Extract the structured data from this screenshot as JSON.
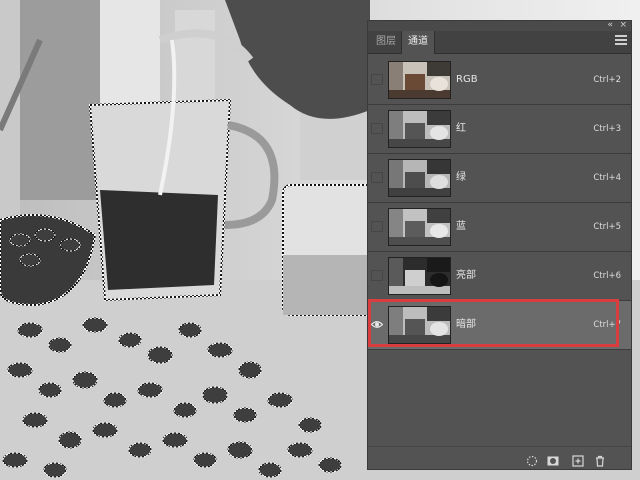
{
  "panel": {
    "collapse_glyph": "«",
    "close_glyph": "×",
    "tabs": [
      {
        "label": "图层",
        "active": false
      },
      {
        "label": "通道",
        "active": true
      }
    ],
    "menu_icon": "menu-icon"
  },
  "channels": [
    {
      "name": "RGB",
      "shortcut": "Ctrl+2",
      "visible": false,
      "selected": false,
      "thumb": "color"
    },
    {
      "name": "红",
      "shortcut": "Ctrl+3",
      "visible": false,
      "selected": false,
      "thumb": "gray"
    },
    {
      "name": "绿",
      "shortcut": "Ctrl+4",
      "visible": false,
      "selected": false,
      "thumb": "gray"
    },
    {
      "name": "蓝",
      "shortcut": "Ctrl+5",
      "visible": false,
      "selected": false,
      "thumb": "gray"
    },
    {
      "name": "亮部",
      "shortcut": "Ctrl+6",
      "visible": false,
      "selected": false,
      "thumb": "dark"
    },
    {
      "name": "暗部",
      "shortcut": "Ctrl+7",
      "visible": true,
      "selected": true,
      "thumb": "gray"
    }
  ],
  "highlight_color": "#d93d3d",
  "bottom_icons": [
    "load-selection-icon",
    "save-selection-icon",
    "new-channel-icon",
    "delete-channel-icon"
  ]
}
